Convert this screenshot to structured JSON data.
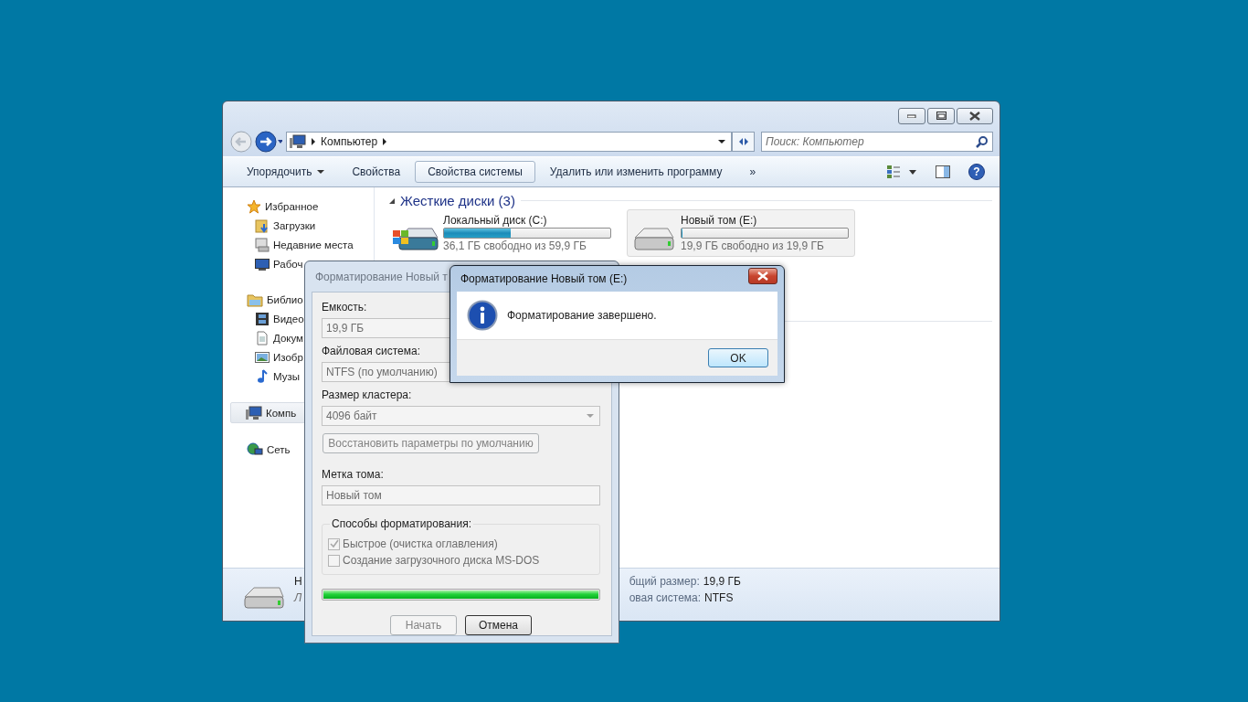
{
  "explorer": {
    "address": {
      "path": "Компьютер"
    },
    "search": {
      "placeholder": "Поиск: Компьютер"
    },
    "toolbar": [
      {
        "label": "Упорядочить",
        "dropdown": true,
        "highlighted": false
      },
      {
        "label": "Свойства",
        "dropdown": false,
        "highlighted": false
      },
      {
        "label": "Свойства системы",
        "dropdown": false,
        "highlighted": true
      },
      {
        "label": "Удалить или изменить программу",
        "dropdown": false,
        "highlighted": false
      },
      {
        "label": "»",
        "dropdown": false,
        "highlighted": false
      }
    ],
    "help": "?",
    "sidebar": [
      {
        "label": "Избранное",
        "kind": "star",
        "selected": false,
        "children": [
          {
            "label": "Загрузки",
            "kind": "downloads",
            "selected": false
          },
          {
            "label": "Недавние места",
            "kind": "recent",
            "selected": false
          },
          {
            "label": "Рабоч",
            "kind": "desktop",
            "selected": false
          }
        ]
      },
      {
        "label": "Библио",
        "kind": "library",
        "selected": false,
        "children": [
          {
            "label": "Видео",
            "kind": "video",
            "selected": false
          },
          {
            "label": "Докум",
            "kind": "document",
            "selected": false
          },
          {
            "label": "Изобр",
            "kind": "picture",
            "selected": false
          },
          {
            "label": "Музы",
            "kind": "music",
            "selected": false
          }
        ]
      },
      {
        "label": "Компь",
        "kind": "computer",
        "selected": true
      },
      {
        "label": "Сеть",
        "kind": "network",
        "selected": false
      }
    ],
    "group": {
      "title": "Жесткие диски (3)",
      "expanded": true
    },
    "drives": [
      {
        "name": "Локальный диск (C:)",
        "kind": "system",
        "level": 0.4,
        "free": "36,1 ГБ свободно из 59,9 ГБ",
        "selected": false
      },
      {
        "name": "Новый том (E:)",
        "kind": "data",
        "level": 0,
        "free": "19,9 ГБ свободно из 19,9 ГБ",
        "selected": true
      }
    ],
    "details": {
      "name": "Н",
      "subtitle": "Л",
      "fields": [
        {
          "label": "бщий размер:",
          "value": "19,9 ГБ"
        },
        {
          "label": "овая система:",
          "value": "NTFS"
        }
      ]
    }
  },
  "format_dialog": {
    "title": "Форматирование Новый т",
    "capacity": {
      "label": "Емкость:",
      "value": "19,9 ГБ"
    },
    "file_system": {
      "label": "Файловая система:",
      "value": "NTFS (по умолчанию)"
    },
    "cluster": {
      "label": "Размер кластера:",
      "value": "4096 байт"
    },
    "restore_button": {
      "label": "Восстановить параметры по умолчанию",
      "disabled": true
    },
    "volume_label": {
      "label": "Метка тома:",
      "value": "Новый том"
    },
    "options_title": "Способы форматирования:",
    "options": [
      {
        "label": "Быстрое (очистка оглавления)",
        "checked": true,
        "disabled": true
      },
      {
        "label": "Создание загрузочного диска MS-DOS",
        "checked": false,
        "disabled": true
      }
    ],
    "progress": {
      "level": 1
    },
    "buttons": [
      {
        "label": "Начать",
        "disabled": true
      },
      {
        "label": "Отмена",
        "disabled": false
      }
    ]
  },
  "message_box": {
    "title": "Форматирование Новый том (E:)",
    "message": "Форматирование завершено.",
    "button": "OK"
  }
}
